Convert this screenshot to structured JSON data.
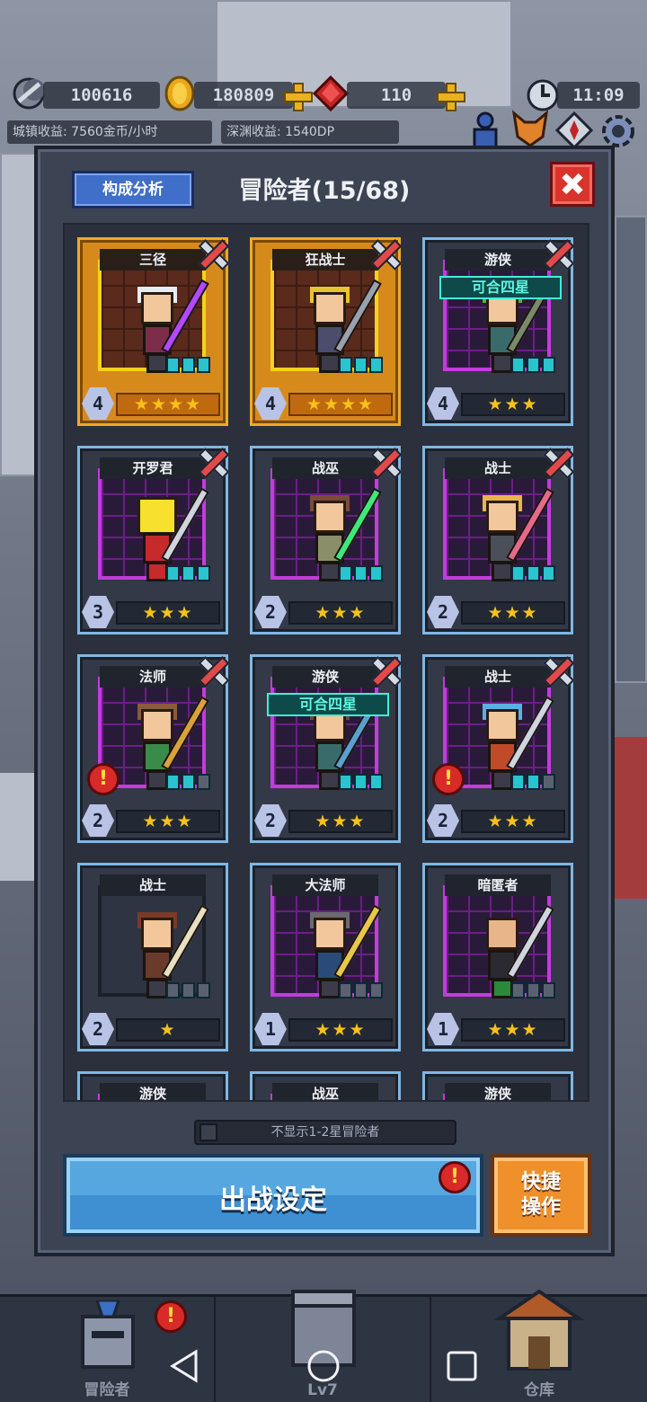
{
  "hud": {
    "moon_value": "100616",
    "gold_value": "180809",
    "gem_value": "110",
    "time": "11:09",
    "town_income": "城镇收益: 7560金币/小时",
    "abyss_income": "深渊收益: 1540DP"
  },
  "dialog": {
    "analysis_label": "构成分析",
    "title": "冒险者(15/68)",
    "filter_label": "不显示1-2星冒险者",
    "deploy_label": "出战设定",
    "quick_label_1": "快捷",
    "quick_label_2": "操作"
  },
  "cards": [
    {
      "name": "三径",
      "level": "4",
      "stars": "★★★★",
      "frame": "gold"
    },
    {
      "name": "狂战士",
      "level": "4",
      "stars": "★★★★",
      "frame": "gold"
    },
    {
      "name": "游侠",
      "level": "4",
      "stars": "★★★",
      "frame": "blue",
      "tag": "可合四星"
    },
    {
      "name": "开罗君",
      "level": "3",
      "stars": "★★★",
      "frame": "blue"
    },
    {
      "name": "战巫",
      "level": "2",
      "stars": "★★★",
      "frame": "blue"
    },
    {
      "name": "战士",
      "level": "2",
      "stars": "★★★",
      "frame": "blue"
    },
    {
      "name": "法师",
      "level": "2",
      "stars": "★★★",
      "frame": "blue",
      "alert": "!"
    },
    {
      "name": "游侠",
      "level": "2",
      "stars": "★★★",
      "frame": "blue",
      "tag": "可合四星"
    },
    {
      "name": "战士",
      "level": "2",
      "stars": "★★★",
      "frame": "blue",
      "alert": "!"
    },
    {
      "name": "战士",
      "level": "2",
      "stars": "★",
      "frame": "plain"
    },
    {
      "name": "大法师",
      "level": "1",
      "stars": "★★★",
      "frame": "blue"
    },
    {
      "name": "暗匿者",
      "level": "1",
      "stars": "★★★",
      "frame": "blue"
    },
    {
      "name": "游侠"
    },
    {
      "name": "战巫"
    },
    {
      "name": "游侠"
    }
  ],
  "nav": {
    "adventurer": "冒险者",
    "level": "Lv7",
    "warehouse": "仓库",
    "alert": "!"
  },
  "colors": {
    "gold_frame": "#f0a92a",
    "blue_frame": "#7fb7e4",
    "deploy": "#56a7e0",
    "quick": "#f0902a",
    "close": "#d8342b"
  }
}
